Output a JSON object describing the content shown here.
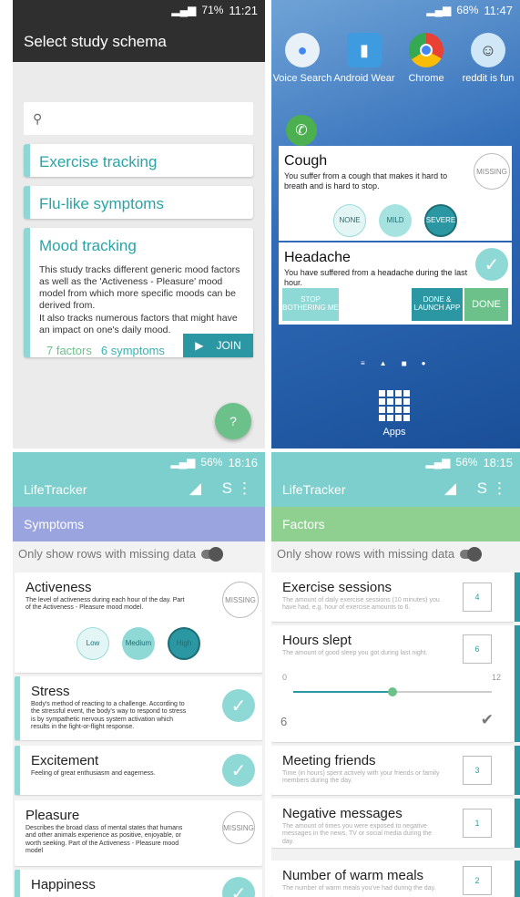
{
  "p1": {
    "status": {
      "battery": "71%",
      "time": "11:21"
    },
    "title": "Select study schema",
    "cards": [
      {
        "title": "Exercise tracking"
      },
      {
        "title": "Flu-like symptoms"
      },
      {
        "title": "Mood tracking",
        "desc": "This study tracks different generic mood factors as well as the 'Activeness - Pleasure' mood model from which more specific moods can be derived from.\nIt also tracks numerous factors that might have an impact on one's daily mood.",
        "factors": "7 factors",
        "symptoms": "6 symptoms",
        "join": "JOIN"
      }
    ]
  },
  "p2": {
    "status": {
      "battery": "68%",
      "time": "11:47"
    },
    "icons": [
      {
        "label": "Voice Search",
        "icon": "mic-icon",
        "color": "#e8f0f8"
      },
      {
        "label": "Android Wear",
        "icon": "watch-icon",
        "color": "#3f9be0"
      },
      {
        "label": "Chrome",
        "icon": "chrome-icon",
        "color": "#e94235"
      },
      {
        "label": "reddit is fun",
        "icon": "reddit-icon",
        "color": "#cfe7f7"
      }
    ],
    "cough": {
      "title": "Cough",
      "desc": "You suffer from a cough that makes it hard to breath and is hard to stop.",
      "missing": "MISSING",
      "opts": [
        "NONE",
        "MILD",
        "SEVERE"
      ]
    },
    "headache": {
      "title": "Headache",
      "desc": "You have suffered from a headache during the last hour.",
      "stop": "STOP BOTHERING ME",
      "launch": "DONE & LAUNCH APP",
      "done": "DONE"
    },
    "apps": "Apps"
  },
  "p3": {
    "status": {
      "battery": "56%",
      "time": "18:16"
    },
    "app": "LifeTracker",
    "section": "Symptoms",
    "section_color": "#9aa4de",
    "toggle": "Only show rows with missing data",
    "rows": [
      {
        "title": "Activeness",
        "desc": "The level of activeness during each hour of the day. Part of the Activeness - Pleasure mood model.",
        "missing": "MISSING",
        "opts": [
          "Low",
          "Medium",
          "High"
        ]
      },
      {
        "title": "Stress",
        "desc": "Body's method of reacting to a challenge. According to the stressful event, the body's way to respond to stress is by sympathetic nervous system activation which results in the fight-or-flight response."
      },
      {
        "title": "Excitement",
        "desc": "Feeling of great enthusiasm and eagerness."
      },
      {
        "title": "Pleasure",
        "desc": "Describes the broad class of mental states that humans and other animals experience as positive, enjoyable, or worth seeking. Part of the Activeness - Pleasure mood model",
        "missing": "MISSING"
      },
      {
        "title": "Happiness"
      }
    ]
  },
  "p4": {
    "status": {
      "battery": "56%",
      "time": "18:15"
    },
    "app": "LifeTracker",
    "section": "Factors",
    "section_color": "#8fcf8f",
    "toggle": "Only show rows with missing data",
    "rows": [
      {
        "title": "Exercise sessions",
        "desc": "The amount of daily exercise sessions (10 minutes) you have had, e.g. hour of exercise amounts to 6.",
        "value": "4"
      },
      {
        "title": "Hours slept",
        "desc": "The amount of good sleep you got during last night.",
        "value": "6",
        "min": "0",
        "max": "12",
        "current": "6",
        "slider_fraction": 0.5
      },
      {
        "title": "Meeting friends",
        "desc": "Time (in hours) spent actively with your friends or family members during the day.",
        "value": "3"
      },
      {
        "title": "Negative messages",
        "desc": "The amount of times you were exposed to negative messages in the news, TV or social media during the day.",
        "value": "1"
      },
      {
        "title": "Number of warm meals",
        "desc": "The number of warm meals you've had during the day.",
        "value": "2"
      }
    ]
  }
}
